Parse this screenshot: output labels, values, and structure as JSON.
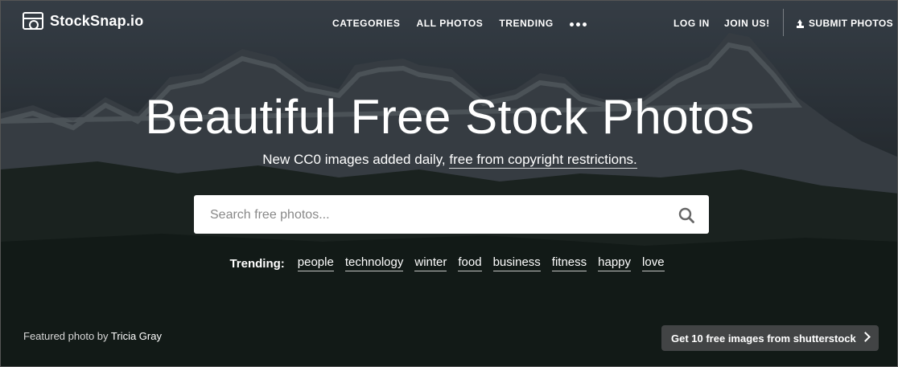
{
  "brand": {
    "name": "StockSnap.io",
    "logo_icon": "camera-icon"
  },
  "nav": {
    "items": [
      "CATEGORIES",
      "ALL PHOTOS",
      "TRENDING"
    ],
    "more_icon": "more-dots-icon",
    "right": {
      "login": "LOG IN",
      "join": "JOIN US!",
      "submit": "SUBMIT PHOTOS",
      "submit_icon": "upload-icon"
    }
  },
  "hero": {
    "title": "Beautiful Free Stock Photos",
    "subtitle_prefix": "New CC0 images added daily, ",
    "subtitle_link": "free from copyright restrictions."
  },
  "search": {
    "placeholder": "Search free photos...",
    "value": "",
    "icon": "search-icon"
  },
  "trending": {
    "label": "Trending:",
    "tags": [
      "people",
      "technology",
      "winter",
      "food",
      "business",
      "fitness",
      "happy",
      "love"
    ]
  },
  "footer": {
    "featured_prefix": "Featured photo by ",
    "photographer": "Tricia Gray",
    "promo": "Get 10 free images from shutterstock",
    "promo_icon": "chevron-right-icon"
  },
  "colors": {
    "text": "#ffffff",
    "search_bg": "#ffffff",
    "promo_bg": "#46484a"
  }
}
